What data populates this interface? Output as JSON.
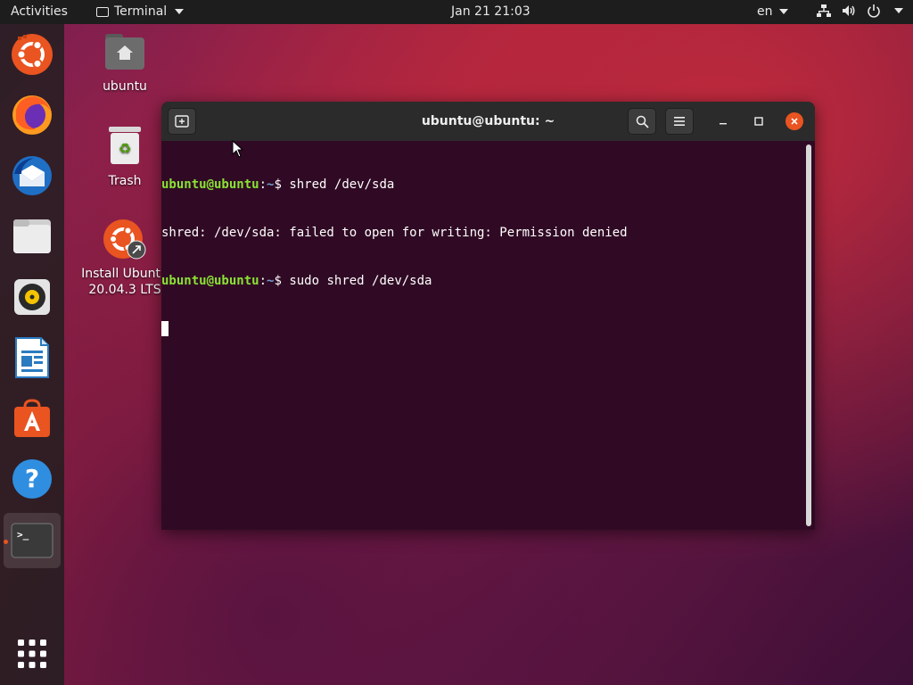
{
  "topbar": {
    "activities": "Activities",
    "app_menu": "Terminal",
    "clock": "Jan 21  21:03",
    "language": "en"
  },
  "dock": {
    "items": [
      {
        "name": "Install Ubuntu"
      },
      {
        "name": "Firefox"
      },
      {
        "name": "Thunderbird"
      },
      {
        "name": "Files"
      },
      {
        "name": "Rhythmbox"
      },
      {
        "name": "LibreOffice Writer"
      },
      {
        "name": "Ubuntu Software"
      },
      {
        "name": "Help"
      },
      {
        "name": "Terminal"
      }
    ],
    "show_apps": "Show Applications"
  },
  "desktop": {
    "home_label": "ubuntu",
    "trash_label": "Trash",
    "installer_label_1": "Install Ubuntu",
    "installer_label_2": "20.04.3 LTS"
  },
  "terminal": {
    "title": "ubuntu@ubuntu: ~",
    "lines": [
      {
        "user": "ubuntu@ubuntu",
        "sep": ":",
        "path": "~",
        "sym": "$ ",
        "cmd": "shred /dev/sda"
      },
      {
        "output": "shred: /dev/sda: failed to open for writing: Permission denied"
      },
      {
        "user": "ubuntu@ubuntu",
        "sep": ":",
        "path": "~",
        "sym": "$ ",
        "cmd": "sudo shred /dev/sda"
      }
    ]
  },
  "colors": {
    "accent": "#e95420",
    "terminal_bg": "#300a24",
    "prompt_user": "#8ae234",
    "prompt_path": "#729fcf"
  }
}
